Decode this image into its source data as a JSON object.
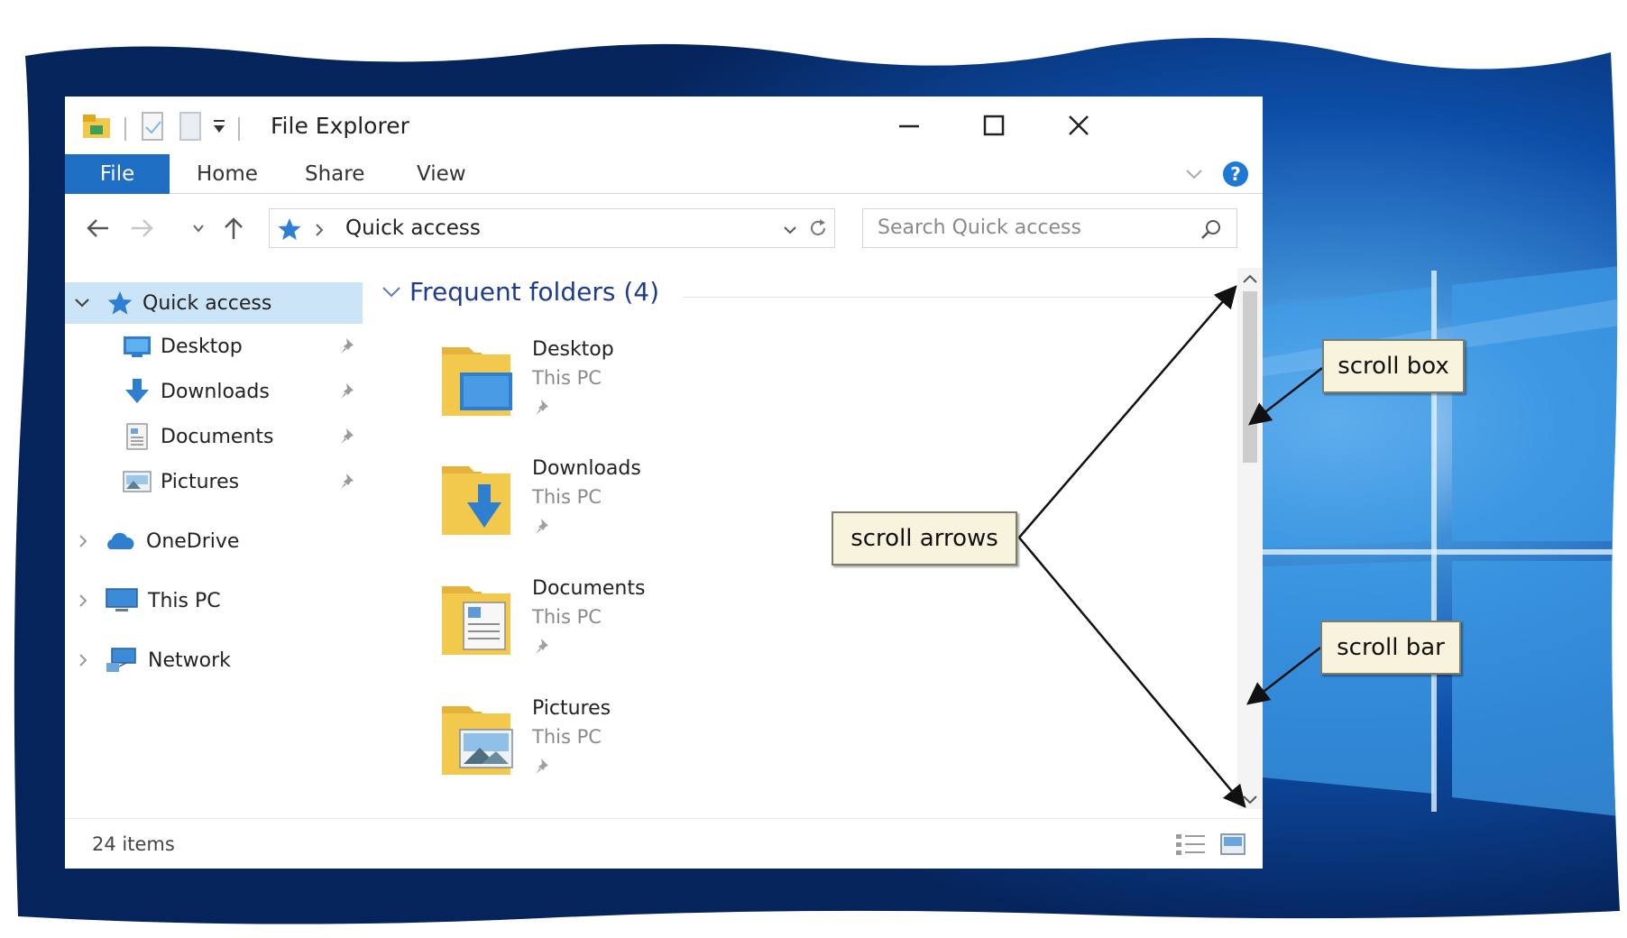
{
  "window": {
    "title": "File Explorer",
    "ribbon_tabs": [
      "File",
      "Home",
      "Share",
      "View"
    ]
  },
  "address_bar": {
    "path": "Quick access",
    "search_placeholder": "Search Quick access"
  },
  "nav_pane": {
    "items": [
      {
        "label": "Quick access",
        "icon": "star-icon",
        "selected": true
      },
      {
        "label": "Desktop",
        "icon": "desktop-folder-icon",
        "pinned": true
      },
      {
        "label": "Downloads",
        "icon": "download-arrow-icon",
        "pinned": true
      },
      {
        "label": "Documents",
        "icon": "documents-icon",
        "pinned": true
      },
      {
        "label": "Pictures",
        "icon": "pictures-icon",
        "pinned": true
      },
      {
        "label": "OneDrive",
        "icon": "cloud-icon"
      },
      {
        "label": "This PC",
        "icon": "computer-icon"
      },
      {
        "label": "Network",
        "icon": "network-icon"
      }
    ]
  },
  "content": {
    "group_title": "Frequent folders (4)",
    "folders": [
      {
        "name": "Desktop",
        "location": "This PC"
      },
      {
        "name": "Downloads",
        "location": "This PC"
      },
      {
        "name": "Documents",
        "location": "This PC"
      },
      {
        "name": "Pictures",
        "location": "This PC"
      }
    ]
  },
  "status_bar": {
    "item_count": "24 items"
  },
  "callouts": {
    "scroll_box": "scroll box",
    "scroll_arrows": "scroll arrows",
    "scroll_bar": "scroll bar"
  },
  "colors": {
    "file_tab": "#1e6fc4",
    "selection": "#cce4f7",
    "group_header": "#1e3c8c",
    "folder_yellow": "#f2c94c",
    "callout_fill": "#f7f3dc",
    "desktop_blue": "#0b3d8f"
  }
}
